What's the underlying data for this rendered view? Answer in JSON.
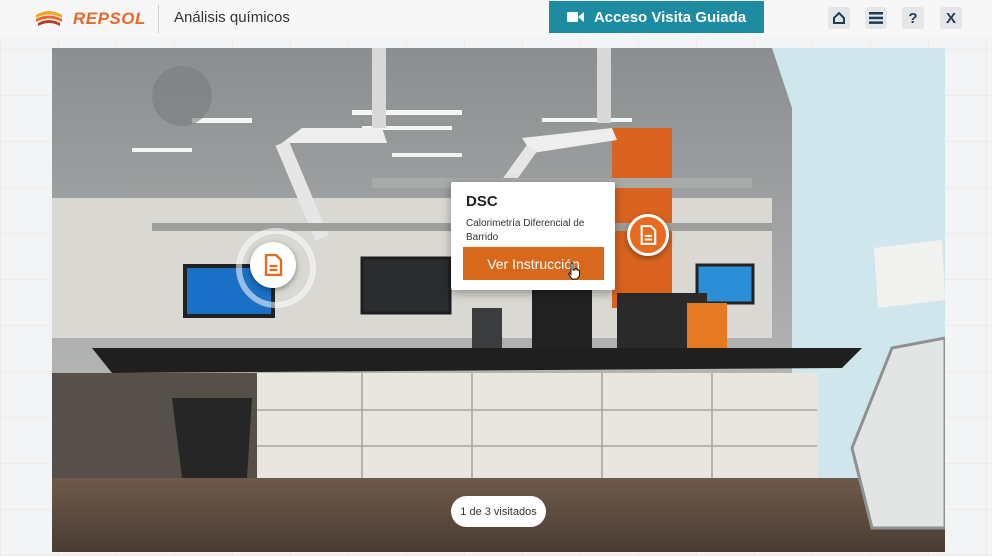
{
  "header": {
    "brand": "REPSOL",
    "app_title": "Análisis químicos",
    "tour_button_label": "Acceso Visita Guiada",
    "icons": [
      "home-icon",
      "menu-icon",
      "help-icon",
      "close-icon"
    ],
    "help_label": "?",
    "close_label": "X"
  },
  "colors": {
    "brand_orange": "#e8682c",
    "tour_teal": "#1e8ca0",
    "button_orange": "#d8691c",
    "icon_navy": "#1d3c5a"
  },
  "hotspot_popup": {
    "title": "DSC",
    "description": "Calorimetría Diferencial de Barrido",
    "button_label": "Ver Instrucción"
  },
  "visit_counter": "1 de 3 visitados"
}
